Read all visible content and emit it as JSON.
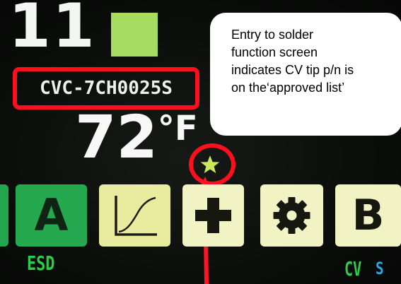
{
  "screen": {
    "channel_number": "11",
    "tip_part_number": "CVC-7CH0025S",
    "temperature_value": "72",
    "temperature_unit": "°F",
    "status_square_color": "#a6dd60"
  },
  "callout": {
    "lines": [
      "Entry to solder",
      "function screen",
      "indicates CV tip p/n is",
      "on the‘approved list’"
    ]
  },
  "buttons": [
    {
      "label": "A",
      "icon": "a-letter",
      "color": "#25a850"
    },
    {
      "label": "",
      "icon": "graph-curve-icon",
      "color": "#e9ec9f"
    },
    {
      "label": "",
      "icon": "plus-icon",
      "color": "#f1f3c4"
    },
    {
      "label": "",
      "icon": "gear-icon",
      "color": "#f1f3c4"
    },
    {
      "label": "B",
      "icon": "b-letter",
      "color": "#f1f3c4"
    }
  ],
  "status_bar": {
    "esd": "ESD",
    "cv": "CV",
    "s": "S"
  },
  "colors": {
    "highlight_red": "#ff0f1e",
    "approved_star": "#cbe85c",
    "status_green": "#2ccc46",
    "status_blue": "#2aa8e8"
  }
}
